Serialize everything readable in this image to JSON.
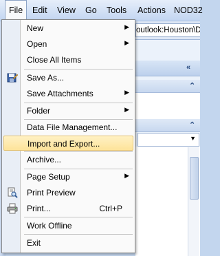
{
  "menubar": {
    "items": [
      "File",
      "Edit",
      "View",
      "Go",
      "Tools",
      "Actions",
      "NOD32"
    ]
  },
  "address": {
    "value": "outlook:Houston\\De"
  },
  "file_menu": {
    "items": [
      {
        "label": "New",
        "submenu": true
      },
      {
        "label": "Open",
        "submenu": true
      },
      {
        "label": "Close All Items"
      },
      {
        "label": "Save As..."
      },
      {
        "label": "Save Attachments",
        "submenu": true
      },
      {
        "label": "Folder",
        "submenu": true
      },
      {
        "label": "Data File Management..."
      },
      {
        "label": "Import and Export...",
        "highlighted": true
      },
      {
        "label": "Archive..."
      },
      {
        "label": "Page Setup",
        "submenu": true
      },
      {
        "label": "Print Preview"
      },
      {
        "label": "Print...",
        "shortcut": "Ctrl+P"
      },
      {
        "label": "Work Offline"
      },
      {
        "label": "Exit"
      }
    ]
  },
  "glyphs": {
    "submenu_arrow": "▶",
    "collapse_left": "«",
    "collapse_up": "⌃",
    "dropdown": "▼"
  },
  "colors": {
    "highlight": "#fde39a",
    "menu_bg": "#fafafa",
    "gutter": "#e9eef6"
  }
}
